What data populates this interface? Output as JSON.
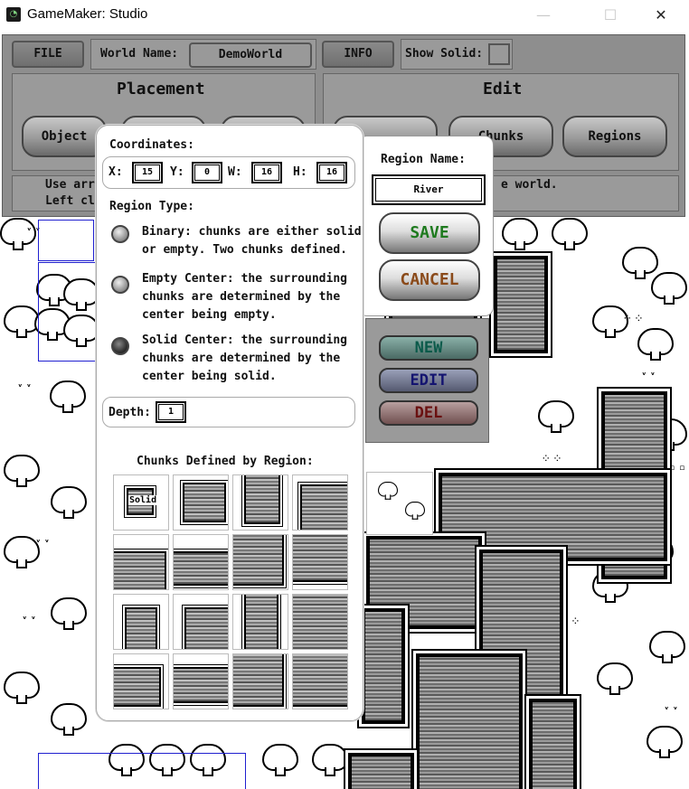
{
  "window": {
    "title": "GameMaker: Studio",
    "minimize": "—",
    "maximize": "☐",
    "close": "✕"
  },
  "toolbar": {
    "file_label": "FILE",
    "world_name_label": "World Name:",
    "world_name_value": "DemoWorld",
    "info_label": "INFO",
    "show_solid_label": "Show Solid:"
  },
  "placement": {
    "title": "Placement",
    "buttons": [
      "Object"
    ]
  },
  "edit": {
    "title": "Edit",
    "buttons": [
      "Chunks",
      "Regions"
    ]
  },
  "help": {
    "line1": "Use arro",
    "line2": "Left clic",
    "line3": "e world."
  },
  "region_dialog": {
    "coordinates_label": "Coordinates:",
    "x_label": "X:",
    "x_value": "15",
    "y_label": "Y:",
    "y_value": "0",
    "w_label": "W:",
    "w_value": "16",
    "h_label": "H:",
    "h_value": "16",
    "region_type_label": "Region Type:",
    "options": [
      {
        "line1": "Binary: chunks are either solid",
        "line2": "or empty. Two chunks defined.",
        "line3": ""
      },
      {
        "line1": "Empty Center: the surrounding",
        "line2": "chunks are determined by the",
        "line3": "center being empty."
      },
      {
        "line1": "Solid Center: the surrounding",
        "line2": "chunks are determined by the",
        "line3": "center being solid."
      }
    ],
    "selected_option": 2,
    "depth_label": "Depth:",
    "depth_value": "1",
    "chunks_label": "Chunks Defined by Region:",
    "solid_tag": "Solid"
  },
  "name_popup": {
    "label": "Region Name:",
    "value": "River",
    "save": "SAVE",
    "cancel": "CANCEL"
  },
  "region_list": {
    "new": "NEW",
    "edit": "EDIT",
    "del": "DEL"
  },
  "colors": {
    "save": "#1e7a1e",
    "cancel": "#8a4a1a",
    "new": "#0a6a5a",
    "edit": "#1a1a7a",
    "del": "#7a1a1a"
  }
}
